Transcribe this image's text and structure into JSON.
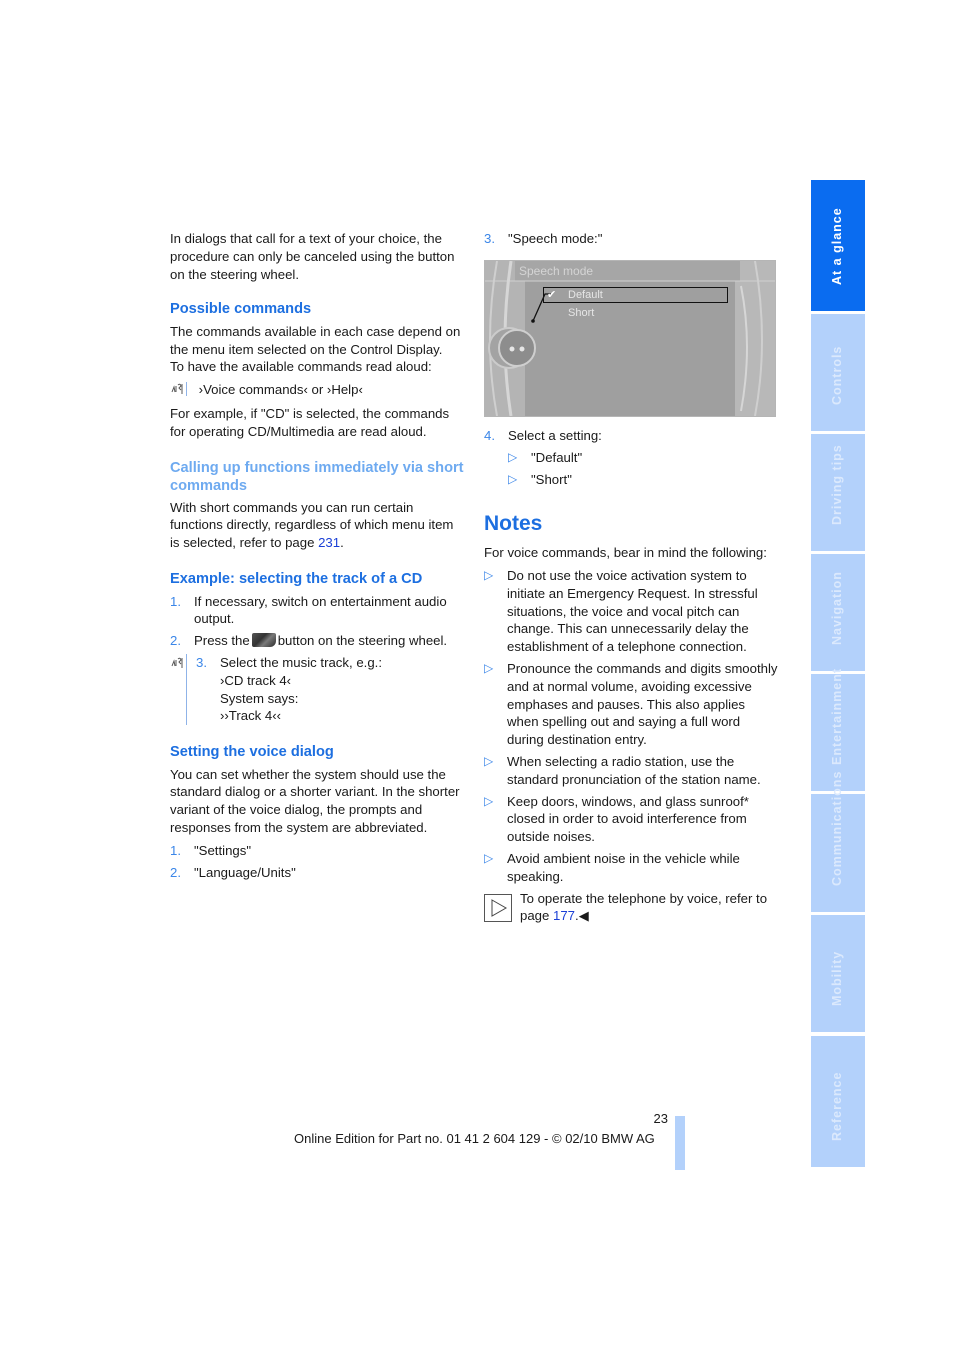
{
  "left_column": {
    "intro": "In dialogs that call for a text of your choice, the procedure can only be canceled using the button on the steering wheel.",
    "possible_commands": {
      "heading": "Possible commands",
      "p1": "The commands available in each case depend on the menu item selected on the Control Display.",
      "p2": "To have the available commands read aloud:",
      "voice_line": "›Voice commands‹ or ›Help‹",
      "p3": "For example, if \"CD\" is selected, the commands for operating CD/Multimedia are read aloud."
    },
    "short_commands": {
      "heading": "Calling up functions immediately via short commands",
      "text": "With short commands you can run certain functions directly, regardless of which menu item is selected, refer to page ",
      "page_link": "231",
      "text_end": "."
    },
    "example": {
      "heading": "Example: selecting the track of a CD",
      "steps": [
        {
          "num": "1.",
          "text": "If necessary, switch on entertainment audio output."
        },
        {
          "num": "2.",
          "text_before": "Press the",
          "text_after": "button on the steering wheel."
        },
        {
          "num": "3.",
          "text": "Select the music track, e.g.:",
          "command": "›CD track 4‹",
          "system_says": "System says:",
          "response": "››Track 4‹‹"
        }
      ]
    },
    "voice_dialog": {
      "heading": "Setting the voice dialog",
      "text": "You can set whether the system should use the standard dialog or a shorter variant. In the shorter variant of the voice dialog, the prompts and responses from the system are abbreviated.",
      "steps": [
        {
          "num": "1.",
          "text": "\"Settings\""
        },
        {
          "num": "2.",
          "text": "\"Language/Units\""
        }
      ]
    }
  },
  "right_column": {
    "step3": {
      "num": "3.",
      "text": "\"Speech mode:\""
    },
    "screen": {
      "title": "Speech mode",
      "options": [
        "Default",
        "Short"
      ],
      "selected": "Default"
    },
    "step4": {
      "num": "4.",
      "text": "Select a setting:",
      "options": [
        "\"Default\"",
        "\"Short\""
      ]
    },
    "notes": {
      "heading": "Notes",
      "intro": "For voice commands, bear in mind the following:",
      "bullets": [
        "Do not use the voice activation system to initiate an Emergency Request. In stressful situations, the voice and vocal pitch can change. This can unnecessarily delay the establishment of a telephone connection.",
        "Pronounce the commands and digits smoothly and at normal volume, avoiding excessive emphases and pauses. This also applies when spelling out and saying a full word during destination entry.",
        "When selecting a radio station, use the standard pronunciation of the station name.",
        "Keep doors, windows, and glass sunroof* closed in order to avoid interference from outside noises.",
        "Avoid ambient noise in the vehicle while speaking."
      ],
      "note": {
        "text": "To operate the telephone by voice, refer to page ",
        "page_link": "177",
        "end": ".◀"
      }
    }
  },
  "sidebar": {
    "tabs": [
      {
        "label": "At a glance",
        "active": true
      },
      {
        "label": "Controls",
        "active": false
      },
      {
        "label": "Driving tips",
        "active": false
      },
      {
        "label": "Navigation",
        "active": false
      },
      {
        "label": "Entertainment",
        "active": false
      },
      {
        "label": "Communications",
        "active": false
      },
      {
        "label": "Mobility",
        "active": false
      },
      {
        "label": "Reference",
        "active": false
      }
    ]
  },
  "footer": {
    "page_number": "23",
    "edition": "Online Edition for Part no. 01 41 2 604 129 - © 02/10 BMW AG"
  },
  "colors": {
    "heading_blue": "#1d6fe0",
    "heading_light_blue": "#6eaaf0",
    "tab_active": "#0a6cf0",
    "tab_inactive": "#b3d1fb",
    "link": "#1a3fd6"
  }
}
